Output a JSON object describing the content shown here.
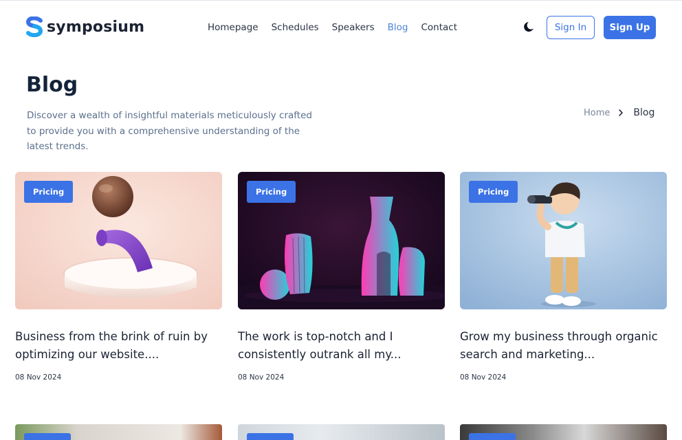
{
  "brand": {
    "name": "symposium",
    "accent": "#3b72e6"
  },
  "nav": {
    "items": [
      {
        "label": "Homepage",
        "active": false
      },
      {
        "label": "Schedules",
        "active": false
      },
      {
        "label": "Speakers",
        "active": false
      },
      {
        "label": "Blog",
        "active": true
      },
      {
        "label": "Contact",
        "active": false
      }
    ],
    "theme_icon": "moon-icon",
    "sign_in": "Sign In",
    "sign_up": "Sign Up"
  },
  "hero": {
    "title": "Blog",
    "description": "Discover a wealth of insightful materials meticulously crafted to provide you with a comprehensive understanding of the latest trends.",
    "breadcrumb": {
      "home": "Home",
      "current": "Blog"
    }
  },
  "posts": [
    {
      "tag": "Pricing",
      "title": "Business from the brink of ruin by optimizing our website....",
      "date": "08 Nov 2024",
      "image": "pink-abstract-sphere"
    },
    {
      "tag": "Pricing",
      "title": "The work is top-notch and I consistently outrank all my...",
      "date": "08 Nov 2024",
      "image": "neon-vases"
    },
    {
      "tag": "Pricing",
      "title": "Grow my business through organic search and marketing...",
      "date": "08 Nov 2024",
      "image": "boy-with-binoculars"
    }
  ]
}
